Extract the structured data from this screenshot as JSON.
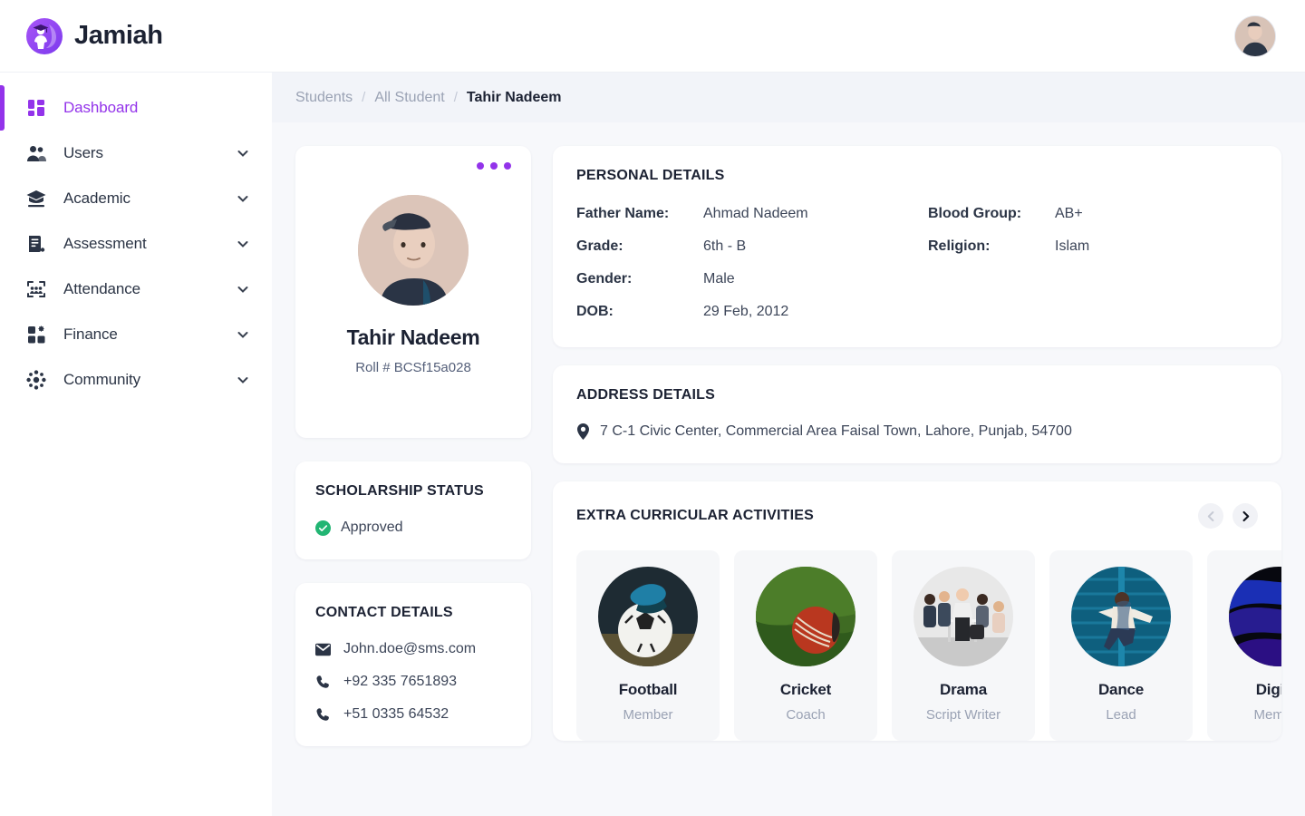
{
  "brand": {
    "name": "Jamiah",
    "logo_icon": "graduate-logo-icon",
    "accent_color": "#9333ea"
  },
  "header": {
    "avatar_icon": "user-avatar"
  },
  "sidebar": {
    "items": [
      {
        "label": "Dashboard",
        "icon": "dashboard-icon",
        "active": true,
        "expandable": false
      },
      {
        "label": "Users",
        "icon": "users-icon",
        "active": false,
        "expandable": true
      },
      {
        "label": "Academic",
        "icon": "graduation-cap-icon",
        "active": false,
        "expandable": true
      },
      {
        "label": "Assessment",
        "icon": "document-icon",
        "active": false,
        "expandable": true
      },
      {
        "label": "Attendance",
        "icon": "attendance-icon",
        "active": false,
        "expandable": true
      },
      {
        "label": "Finance",
        "icon": "finance-grid-icon",
        "active": false,
        "expandable": true
      },
      {
        "label": "Community",
        "icon": "community-icon",
        "active": false,
        "expandable": true
      }
    ]
  },
  "breadcrumb": {
    "items": [
      "Students",
      "All Student",
      "Tahir Nadeem"
    ],
    "separator": "/"
  },
  "profile": {
    "name": "Tahir Nadeem",
    "roll": "Roll # BCSf15a028",
    "menu_icon": "more-options-icon",
    "photo_icon": "student-photo"
  },
  "scholarship": {
    "title": "SCHOLARSHIP STATUS",
    "status": "Approved",
    "status_icon": "check-circle-icon",
    "status_color": "#22b573"
  },
  "contact": {
    "title": "CONTACT DETAILS",
    "items": [
      {
        "icon": "mail-icon",
        "value": "John.doe@sms.com"
      },
      {
        "icon": "phone-icon",
        "value": "+92 335 7651893"
      },
      {
        "icon": "phone-icon",
        "value": "+51 0335 64532"
      }
    ]
  },
  "personal": {
    "title": "PERSONAL DETAILS",
    "fields_left": [
      {
        "label": "Father Name:",
        "value": "Ahmad Nadeem"
      },
      {
        "label": "Grade:",
        "value": "6th - B"
      },
      {
        "label": "Gender:",
        "value": "Male"
      },
      {
        "label": "DOB:",
        "value": "29 Feb, 2012"
      }
    ],
    "fields_right": [
      {
        "label": "Blood Group:",
        "value": "AB+"
      },
      {
        "label": "Religion:",
        "value": "Islam"
      }
    ]
  },
  "address": {
    "title": "ADDRESS DETAILS",
    "icon": "location-pin-icon",
    "value": "7 C-1 Civic Center, Commercial Area Faisal Town, Lahore, Punjab, 54700"
  },
  "activities": {
    "title": "EXTRA CURRICULAR ACTIVITIES",
    "prev_icon": "chevron-left-icon",
    "next_icon": "chevron-right-icon",
    "prev_enabled": false,
    "next_enabled": true,
    "items": [
      {
        "name": "Football",
        "role": "Member",
        "image": "football-photo"
      },
      {
        "name": "Cricket",
        "role": "Coach",
        "image": "cricket-ball-photo"
      },
      {
        "name": "Drama",
        "role": "Script Writer",
        "image": "drama-group-photo"
      },
      {
        "name": "Dance",
        "role": "Lead",
        "image": "dancer-photo"
      },
      {
        "name": "Digital",
        "role": "Member",
        "image": "digital-art-photo"
      }
    ]
  }
}
